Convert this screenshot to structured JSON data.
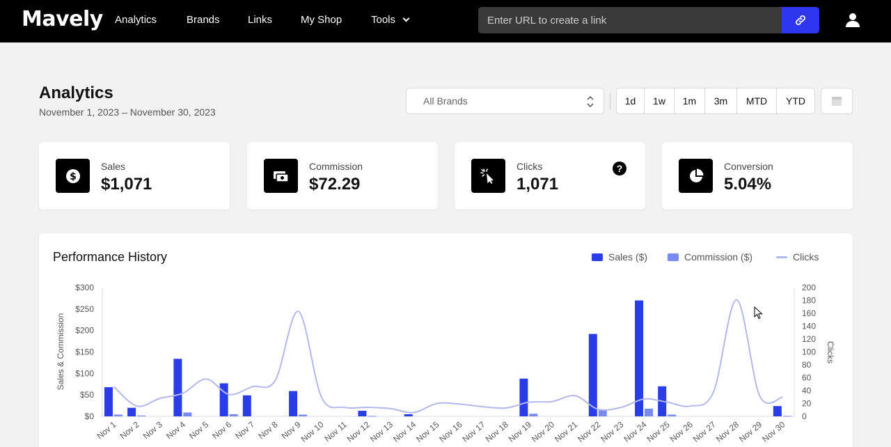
{
  "nav": {
    "logo": "Mavely",
    "items": [
      "Analytics",
      "Brands",
      "Links",
      "My Shop"
    ],
    "tools_label": "Tools",
    "url_placeholder": "Enter URL to create a link",
    "link_icon": "link-icon",
    "user_icon": "user-icon"
  },
  "header": {
    "title": "Analytics",
    "date_range": "November 1, 2023 – November 30, 2023",
    "brand_select": "All Brands",
    "ranges": [
      "1d",
      "1w",
      "1m",
      "3m",
      "MTD",
      "YTD"
    ],
    "calendar_icon": "calendar-icon"
  },
  "stats": [
    {
      "label": "Sales",
      "value": "$1,071",
      "icon": "dollar-icon"
    },
    {
      "label": "Commission",
      "value": "$72.29",
      "icon": "money-icon"
    },
    {
      "label": "Clicks",
      "value": "1,071",
      "icon": "click-icon",
      "help": "?"
    },
    {
      "label": "Conversion",
      "value": "5.04%",
      "icon": "pie-icon"
    }
  ],
  "performance": {
    "title": "Performance History",
    "legend": [
      "Sales ($)",
      "Commission ($)",
      "Clicks"
    ]
  },
  "colors": {
    "sales": "#2a3ee8",
    "commission": "#7889ef",
    "clicks": "#b2b8ec",
    "link_button": "#2f36f0"
  },
  "chart_data": {
    "type": "bar",
    "categories": [
      "Nov 1",
      "Nov 2",
      "Nov 3",
      "Nov 4",
      "Nov 5",
      "Nov 6",
      "Nov 7",
      "Nov 8",
      "Nov 9",
      "Nov 10",
      "Nov 11",
      "Nov 12",
      "Nov 13",
      "Nov 14",
      "Nov 15",
      "Nov 16",
      "Nov 17",
      "Nov 18",
      "Nov 19",
      "Nov 20",
      "Nov 21",
      "Nov 22",
      "Nov 23",
      "Nov 24",
      "Nov 25",
      "Nov 26",
      "Nov 27",
      "Nov 28",
      "Nov 29",
      "Nov 30"
    ],
    "series": [
      {
        "name": "Sales ($)",
        "axis": "left",
        "values": [
          68,
          20,
          0,
          134,
          0,
          77,
          49,
          0,
          59,
          0,
          0,
          13,
          0,
          5,
          0,
          0,
          0,
          0,
          88,
          0,
          0,
          192,
          0,
          270,
          70,
          0,
          0,
          0,
          0,
          24
        ]
      },
      {
        "name": "Commission ($)",
        "axis": "left",
        "values": [
          4,
          2,
          0,
          9,
          0,
          5,
          0,
          0,
          4,
          0,
          0,
          1,
          0,
          0,
          0,
          0,
          0,
          0,
          6,
          0,
          0,
          14,
          0,
          18,
          4,
          0,
          0,
          0,
          0,
          1
        ]
      },
      {
        "name": "Clicks",
        "axis": "right",
        "type": "line",
        "values": [
          46,
          16,
          28,
          36,
          58,
          34,
          46,
          56,
          163,
          30,
          14,
          14,
          12,
          6,
          20,
          19,
          15,
          13,
          22,
          23,
          32,
          11,
          14,
          27,
          22,
          16,
          38,
          181,
          32,
          30
        ]
      }
    ],
    "ylabel_left": "Sales & Commission",
    "ylabel_right": "Clicks",
    "yticks_left": [
      "$0",
      "$50",
      "$100",
      "$150",
      "$200",
      "$250",
      "$300"
    ],
    "yticks_right": [
      "0",
      "20",
      "40",
      "60",
      "80",
      "100",
      "120",
      "140",
      "160",
      "180",
      "200"
    ],
    "ylim_left": [
      0,
      300
    ],
    "ylim_right": [
      0,
      200
    ],
    "legend_position": "top-right"
  }
}
